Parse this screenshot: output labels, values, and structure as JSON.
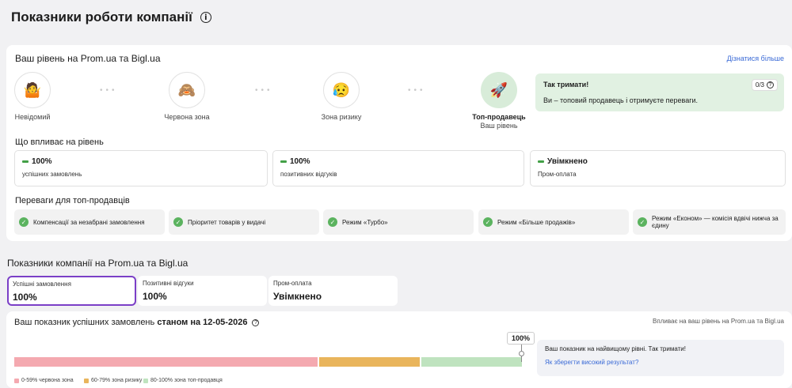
{
  "page": {
    "title": "Показники роботи компанії",
    "info_icon": "info-icon"
  },
  "level_card": {
    "title": "Ваш рівень на Prom.ua та Bigl.ua",
    "learn_more": "Дізнатися більше",
    "levels": [
      {
        "icon": "unknown-emoji-icon",
        "glyph": "🤷",
        "name": "Невідомий",
        "sub": ""
      },
      {
        "icon": "monkey-emoji-icon",
        "glyph": "🙈",
        "name": "Червона зона",
        "sub": ""
      },
      {
        "icon": "worried-emoji-icon",
        "glyph": "😥",
        "name": "Зона ризику",
        "sub": ""
      },
      {
        "icon": "rocket-icon",
        "glyph": "🚀",
        "name": "Топ-продавець",
        "sub": "Ваш рівень"
      }
    ],
    "tip": {
      "title": "Так тримати!",
      "text": "Ви – топовий продавець і отримуєте переваги.",
      "counter": "0/3"
    },
    "affects_title": "Що впливає на рівень",
    "metrics": [
      {
        "value": "100%",
        "label": "успішних замовлень"
      },
      {
        "value": "100%",
        "label": "позитивних відгуків"
      },
      {
        "value": "Увімкнено",
        "label": "Пром-оплата"
      }
    ],
    "benefits_title": "Переваги для топ-продавців",
    "benefits": [
      "Компенсації за незабрані замовлення",
      "Пріоритет товарів у видачі",
      "Режим «Турбо»",
      "Режим «Більше продажів»",
      "Режим «Економ» — комісія вдвічі нижча за єдину"
    ]
  },
  "company_stats": {
    "title": "Показники компанії на Prom.ua та Bigl.ua",
    "tabs": [
      {
        "label": "Успішні замовлення",
        "value": "100%",
        "selected": true
      },
      {
        "label": "Позитивні відгуки",
        "value": "100%",
        "selected": false
      },
      {
        "label": "Пром-оплата",
        "value": "Увімкнено",
        "selected": false
      }
    ]
  },
  "indicator": {
    "title_prefix": "Ваш показник успішних замовлень",
    "title_bold": "станом на 12-05-2026",
    "affects_note": "Впливає на ваш рівень на Prom.ua та Bigl.ua",
    "current_value": "100%",
    "current_fraction": 1.0,
    "zones": [
      {
        "label": "0-59% червона зона",
        "color": "#f4a9b0"
      },
      {
        "label": "60-79% зона ризику",
        "color": "#e9b55c"
      },
      {
        "label": "80-100% зона топ-продавця",
        "color": "#bfe3bf"
      }
    ],
    "status_text": "Ваш показник на найвищому рівні. Так тримати!",
    "status_link": "Як зберегти високий результат?"
  }
}
